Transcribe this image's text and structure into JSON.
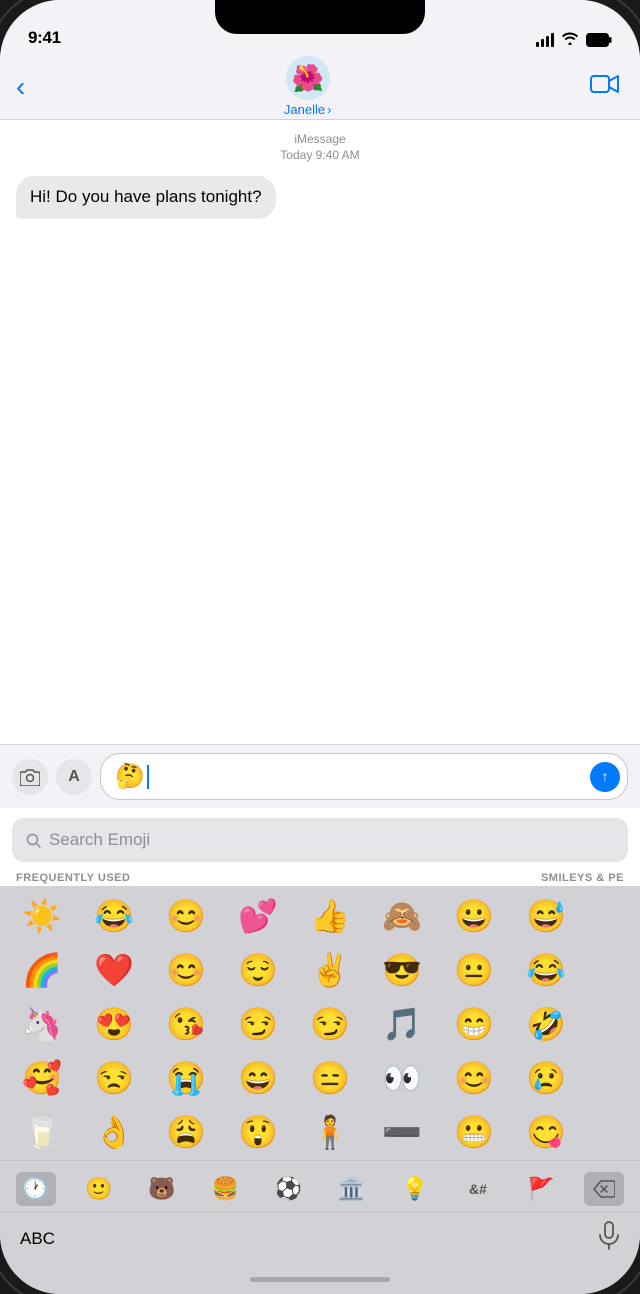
{
  "statusBar": {
    "time": "9:41",
    "signal": "●●●●",
    "wifi": "wifi",
    "battery": "battery"
  },
  "nav": {
    "backLabel": "‹",
    "contactName": "Janelle",
    "contactEmoji": "🌺",
    "arrowLabel": "›",
    "videoIcon": "📹"
  },
  "message": {
    "serviceLabel": "iMessage",
    "timeLabel": "Today 9:40 AM",
    "bubbleText": "Hi! Do you have plans tonight?"
  },
  "inputArea": {
    "cameraLabel": "📷",
    "appLabel": "🅐",
    "inputEmoji": "🤔",
    "sendLabel": "↑"
  },
  "emojiKeyboard": {
    "searchPlaceholder": "Search Emoji",
    "sectionLeft": "FREQUENTLY USED",
    "sectionRight": "SMILEYS & PE",
    "rows": [
      [
        "☀️",
        "😂",
        "😊",
        "💕",
        "👍",
        "🙈",
        "😀",
        "😅"
      ],
      [
        "🌈",
        "❤️",
        "😊",
        "😌",
        "✌️",
        "😎",
        "😐",
        "😂"
      ],
      [
        "🦄",
        "😍",
        "😘",
        "😏",
        "😏",
        "🎵",
        "😁",
        "🤣"
      ],
      [
        "🥰",
        "😒",
        "😭",
        "😄",
        "😑",
        "👀",
        "😊",
        "😢"
      ],
      [
        "🥛",
        "👌",
        "😩",
        "😲",
        "🧍",
        "➖",
        "😬",
        "😋"
      ]
    ],
    "categories": [
      {
        "icon": "🕐",
        "active": true
      },
      {
        "icon": "🙂",
        "active": false
      },
      {
        "icon": "🐻",
        "active": false
      },
      {
        "icon": "🍔",
        "active": false
      },
      {
        "icon": "⚽",
        "active": false
      },
      {
        "icon": "🏛️",
        "active": false
      },
      {
        "icon": "💡",
        "active": false
      },
      {
        "icon": "🔣",
        "active": false
      },
      {
        "icon": "🚩",
        "active": false
      }
    ],
    "deleteIcon": "⌫"
  },
  "bottomBar": {
    "abcLabel": "ABC",
    "micIcon": "🎤"
  }
}
